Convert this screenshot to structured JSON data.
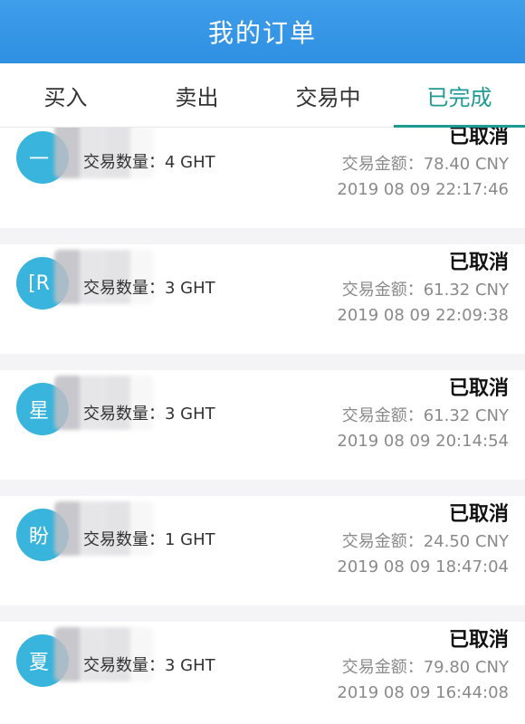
{
  "header": {
    "title": "我的订单"
  },
  "tabs": [
    {
      "label": "买入"
    },
    {
      "label": "卖出"
    },
    {
      "label": "交易中"
    },
    {
      "label": "已完成",
      "active": true
    }
  ],
  "colors": {
    "header": "#2f8fe2",
    "active_tab": "#1e9a93",
    "avatar": "#38b4dd"
  },
  "orders": [
    {
      "avatar_char": "一",
      "quantity": "交易数量：4 GHT",
      "status": "已取消",
      "amount": "交易金额：78.40 CNY",
      "time": "2019 08 09 22:17:46"
    },
    {
      "avatar_char": "[R",
      "quantity": "交易数量：3 GHT",
      "status": "已取消",
      "amount": "交易金额：61.32 CNY",
      "time": "2019 08 09 22:09:38"
    },
    {
      "avatar_char": "星",
      "quantity": "交易数量：3 GHT",
      "status": "已取消",
      "amount": "交易金额：61.32 CNY",
      "time": "2019 08 09 20:14:54"
    },
    {
      "avatar_char": "盼",
      "quantity": "交易数量：1 GHT",
      "status": "已取消",
      "amount": "交易金额：24.50 CNY",
      "time": "2019 08 09 18:47:04"
    },
    {
      "avatar_char": "夏",
      "quantity": "交易数量：3 GHT",
      "status": "已取消",
      "amount": "交易金额：79.80 CNY",
      "time": "2019 08 09 16:44:08"
    }
  ]
}
